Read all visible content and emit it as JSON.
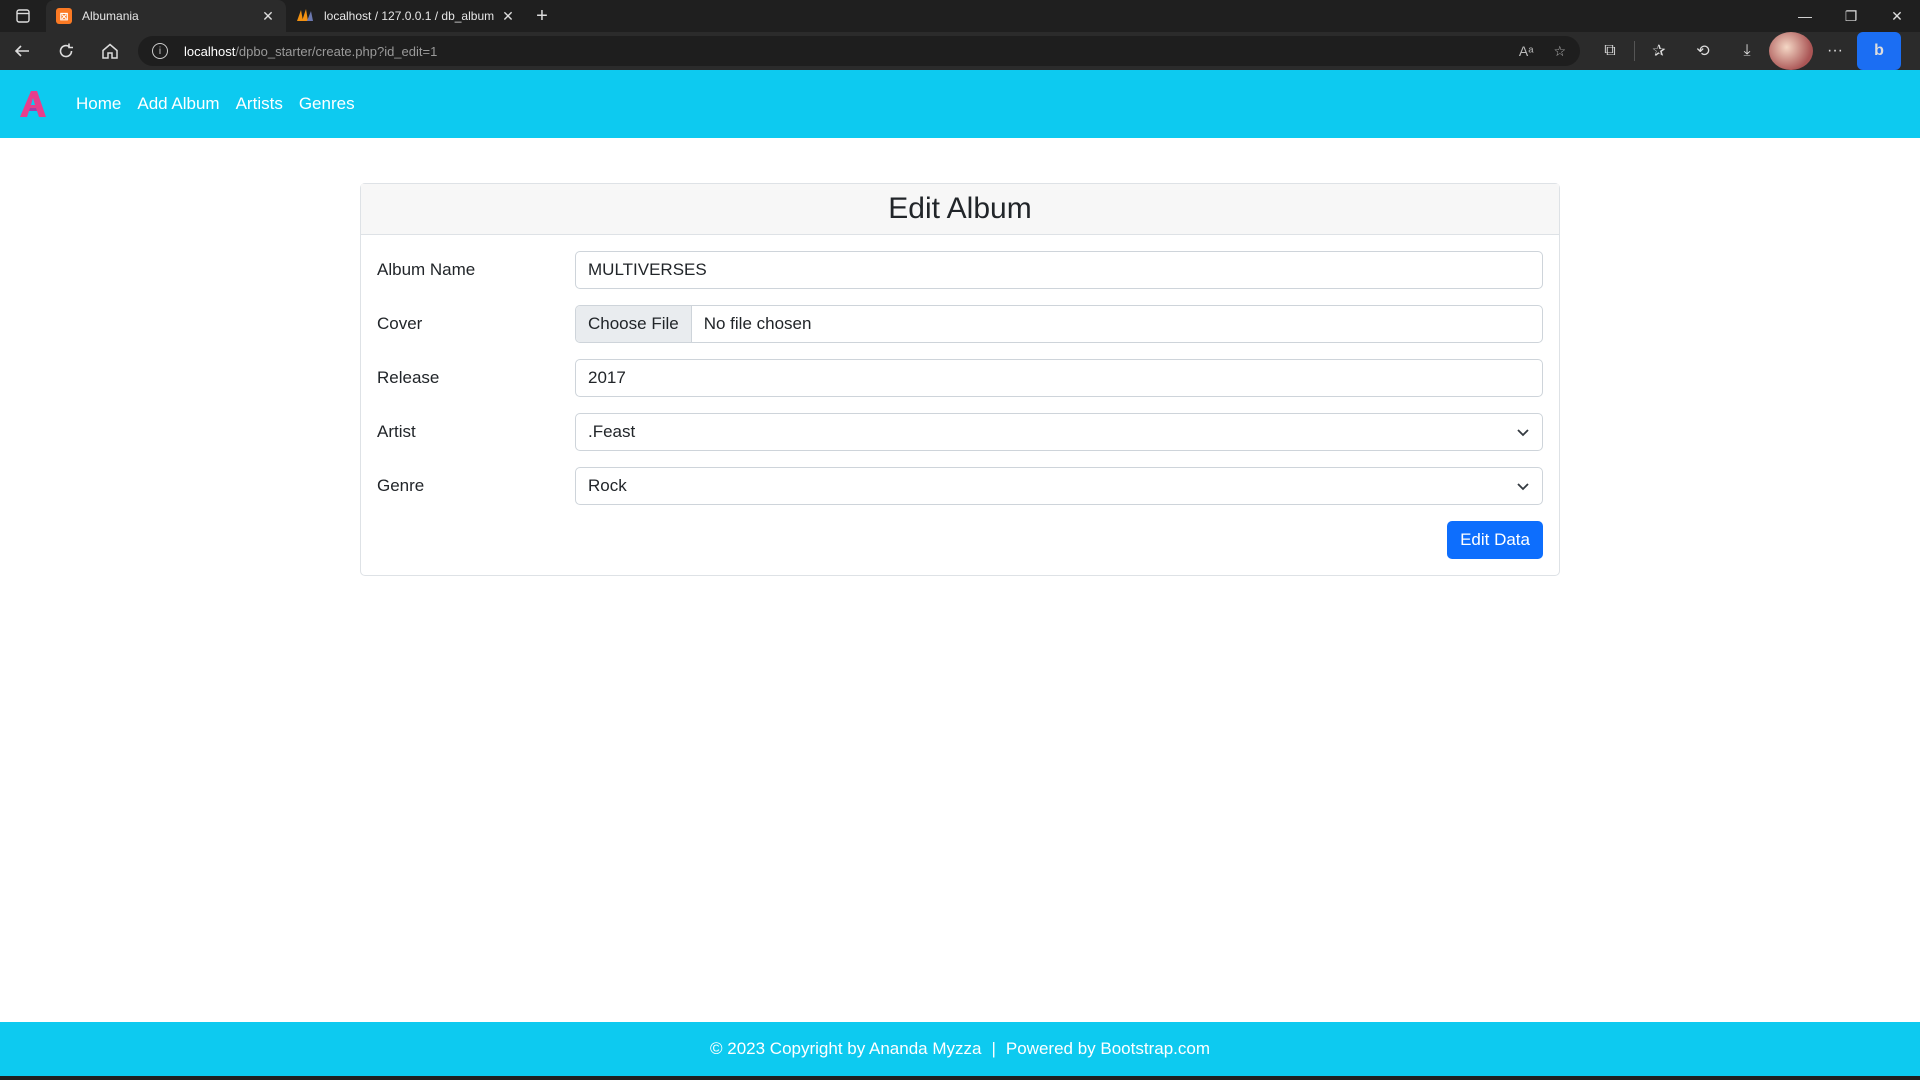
{
  "browser": {
    "tabs": [
      {
        "title": "Albumania",
        "active": true
      },
      {
        "title": "localhost / 127.0.0.1 / db_album",
        "active": false
      }
    ],
    "url_host": "localhost",
    "url_path": "/dpbo_starter/create.php?id_edit=1",
    "read_aloud_label": "Aᵃ"
  },
  "navbar": {
    "brand_color": "#e83e8c",
    "links": [
      "Home",
      "Add Album",
      "Artists",
      "Genres"
    ]
  },
  "form": {
    "title": "Edit Album",
    "fields": {
      "album_name": {
        "label": "Album Name",
        "value": "MULTIVERSES"
      },
      "cover": {
        "label": "Cover",
        "button": "Choose File",
        "status": "No file chosen"
      },
      "release": {
        "label": "Release",
        "value": "2017"
      },
      "artist": {
        "label": "Artist",
        "value": ".Feast"
      },
      "genre": {
        "label": "Genre",
        "value": "Rock"
      }
    },
    "submit_label": "Edit Data",
    "accent_color": "#0d6efd"
  },
  "footer": {
    "copyright": "© 2023 Copyright by Ananda Myzza",
    "separator": "|",
    "powered": "Powered by Bootstrap.com",
    "background": "#0dcaf0"
  }
}
